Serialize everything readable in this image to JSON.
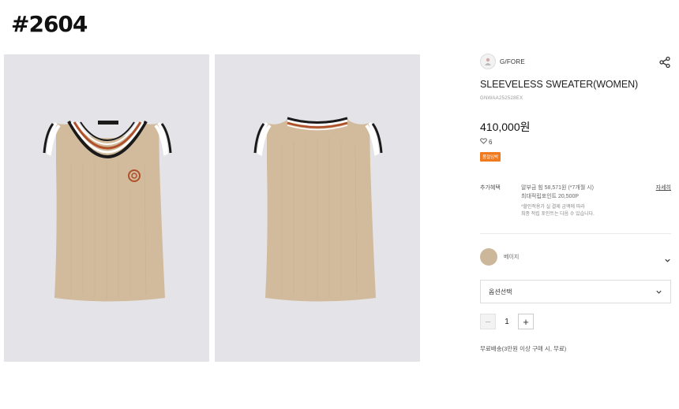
{
  "page_tag": "#2604",
  "product": {
    "brand": "G/FORE",
    "title": "SLEEVELESS SWEATER(WOMEN)",
    "code": "GNWAA252528EX",
    "price": "410,000원",
    "likes": "6",
    "badge": "품절임박"
  },
  "benefits": {
    "label": "추가혜택",
    "installment": "알부금 힘 58,571원 (*7개월 시)",
    "points": "최대적립포인트 20,500P",
    "note_line1": "*할인적용가 실 결제 금액에 따라",
    "note_line2": "최종 적립 포인트는 다음 수 있습니다.",
    "details_link": "자세히"
  },
  "color_option": {
    "name": "베이지",
    "swatch": "#cdb79a"
  },
  "option_select": {
    "label": "옵션선택"
  },
  "quantity": {
    "minus": "−",
    "value": "1",
    "plus": "+"
  },
  "shipping": "무료배송(3만원 이상 구매 시, 무료)",
  "colors": {
    "badge": "#f07a1e",
    "background_photo": "#e4e4e8",
    "sweater": "#d2bb9c"
  },
  "icons": {
    "share": "share-icon",
    "heart": "heart-icon",
    "chevron": "chevron-down-icon"
  }
}
